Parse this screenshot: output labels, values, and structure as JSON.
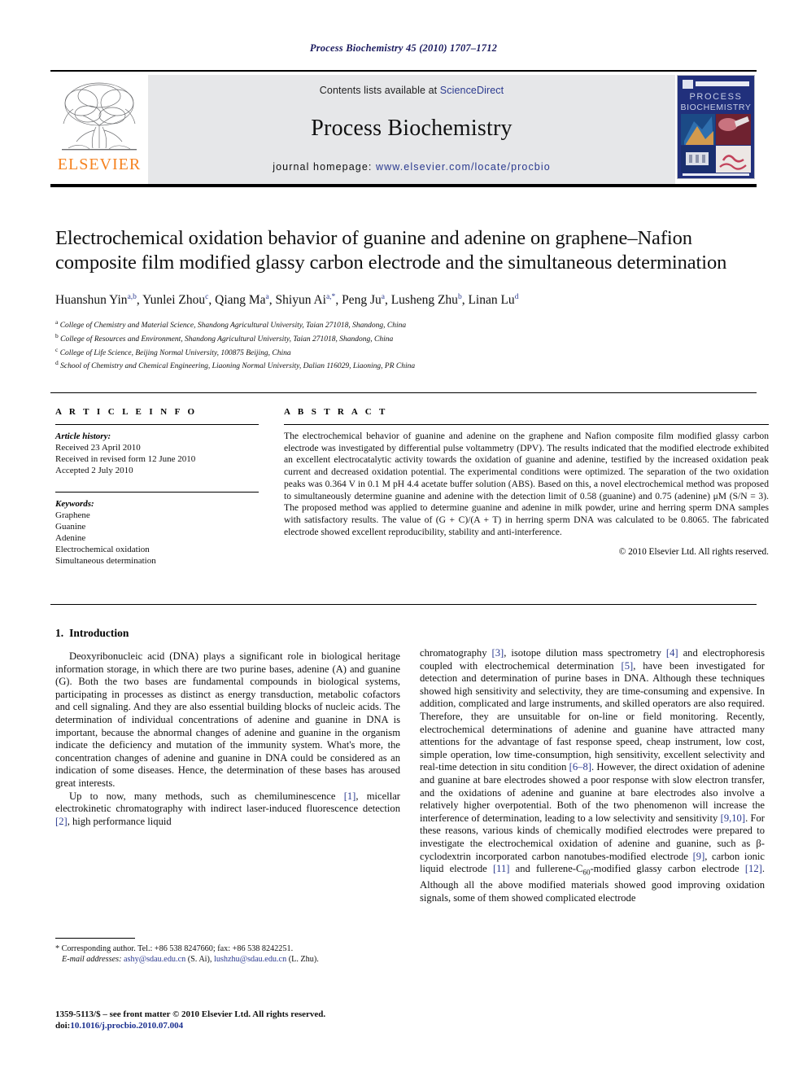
{
  "running_head": "Process Biochemistry 45 (2010) 1707–1712",
  "masthead": {
    "contents_prefix": "Contents lists available at ",
    "sciencedirect": "ScienceDirect",
    "journal_title": "Process Biochemistry",
    "homepage_prefix": "journal homepage: ",
    "homepage_url": "www.elsevier.com/locate/procbio",
    "publisher": "ELSEVIER",
    "cover_title_line1": "PROCESS",
    "cover_title_line2": "BIOCHEMISTRY",
    "accent_orange": "#f58220",
    "link_blue": "#2b3a8f"
  },
  "article": {
    "title": "Electrochemical oxidation behavior of guanine and adenine on graphene–Nafion composite film modified glassy carbon electrode and the simultaneous determination",
    "authors": [
      {
        "name": "Huanshun Yin",
        "sup": "a,b"
      },
      {
        "name": "Yunlei Zhou",
        "sup": "c"
      },
      {
        "name": "Qiang Ma",
        "sup": "a"
      },
      {
        "name": "Shiyun Ai",
        "sup": "a,*"
      },
      {
        "name": "Peng Ju",
        "sup": "a"
      },
      {
        "name": "Lusheng Zhu",
        "sup": "b"
      },
      {
        "name": "Linan Lu",
        "sup": "d"
      }
    ],
    "affiliations": [
      {
        "marker": "a",
        "text": "College of Chemistry and Material Science, Shandong Agricultural University, Taian 271018, Shandong, China"
      },
      {
        "marker": "b",
        "text": "College of Resources and Environment, Shandong Agricultural University, Taian 271018, Shandong, China"
      },
      {
        "marker": "c",
        "text": "College of Life Science, Beijing Normal University, 100875 Beijing, China"
      },
      {
        "marker": "d",
        "text": "School of Chemistry and Chemical Engineering, Liaoning Normal University, Dalian 116029, Liaoning, PR China"
      }
    ]
  },
  "article_info": {
    "heading": "A R T I C L E   I N F O",
    "history_label": "Article history:",
    "history": [
      "Received 23 April 2010",
      "Received in revised form 12 June 2010",
      "Accepted 2 July 2010"
    ],
    "keywords_label": "Keywords:",
    "keywords": [
      "Graphene",
      "Guanine",
      "Adenine",
      "Electrochemical oxidation",
      "Simultaneous determination"
    ]
  },
  "abstract": {
    "heading": "A B S T R A C T",
    "text": "The electrochemical behavior of guanine and adenine on the graphene and Nafion composite film modified glassy carbon electrode was investigated by differential pulse voltammetry (DPV). The results indicated that the modified electrode exhibited an excellent electrocatalytic activity towards the oxidation of guanine and adenine, testified by the increased oxidation peak current and decreased oxidation potential. The experimental conditions were optimized. The separation of the two oxidation peaks was 0.364 V in 0.1 M pH 4.4 acetate buffer solution (ABS). Based on this, a novel electrochemical method was proposed to simultaneously determine guanine and adenine with the detection limit of 0.58 (guanine) and 0.75 (adenine) μM (S/N = 3). The proposed method was applied to determine guanine and adenine in milk powder, urine and herring sperm DNA samples with satisfactory results. The value of (G + C)/(A + T) in herring sperm DNA was calculated to be 0.8065. The fabricated electrode showed excellent reproducibility, stability and anti-interference.",
    "copyright": "© 2010 Elsevier Ltd. All rights reserved."
  },
  "introduction": {
    "number": "1.",
    "title": "Introduction",
    "para1_a": "Deoxyribonucleic acid (DNA) plays a significant role in biological heritage information storage, in which there are two purine bases, adenine (A) and guanine (G). Both the two bases are fundamental compounds in biological systems, participating in processes as distinct as energy transduction, metabolic cofactors and cell signaling. And they are also essential building blocks of nucleic acids. The determination of individual concentrations of adenine and guanine in DNA is important, because the abnormal changes of adenine and guanine in the organism indicate the deficiency and mutation of the immunity system. What's more, the concentration changes of adenine and guanine in DNA could be considered as an indication of some diseases. Hence, the determination of these bases has aroused great interests.",
    "para2_seg1": "Up to now, many methods, such as chemiluminescence ",
    "para2_ref1": "[1]",
    "para2_seg2": ", micellar electrokinetic chromatography with indirect laser-induced fluorescence detection ",
    "para2_ref2": "[2]",
    "para2_seg3": ", high performance liquid chromatography ",
    "para2_ref3": "[3]",
    "para2_seg4": ", isotope dilution mass spectrometry ",
    "para2_ref4": "[4]",
    "para2_seg5": " and electrophoresis coupled with electrochemical determination ",
    "para2_ref5": "[5]",
    "para2_seg6": ", have been investigated for detection and determination of purine bases in DNA. Although these techniques showed high sensitivity and selectivity, they are time-consuming and expensive. In addition, complicated and large instruments, and skilled operators are also required. Therefore, they are unsuitable for on-line or field monitoring. Recently, electrochemical determinations of adenine and guanine have attracted many attentions for the advantage of fast response speed, cheap instrument, low cost, simple operation, low time-consumption, high sensitivity, excellent selectivity and real-time detection in situ condition ",
    "para2_ref6": "[6–8]",
    "para2_seg7": ". However, the direct oxidation of adenine and guanine at bare electrodes showed a poor response with slow electron transfer, and the oxidations of adenine and guanine at bare electrodes also involve a relatively higher overpotential. Both of the two phenomenon will increase the interference of determination, leading to a low selectivity and sensitivity ",
    "para2_ref7": "[9,10]",
    "para2_seg8": ". For these reasons, various kinds of chemically modified electrodes were prepared to investigate the electrochemical oxidation of adenine and guanine, such as β-cyclodextrin incorporated carbon nanotubes-modified electrode ",
    "para2_ref8": "[9]",
    "para2_seg9": ", carbon ionic liquid electrode ",
    "para2_ref9": "[11]",
    "para2_seg10": " and fullerene-C",
    "para2_sub": "60",
    "para2_seg11": "-modified glassy carbon electrode ",
    "para2_ref10": "[12]",
    "para2_seg12": ". Although all the above modified materials showed good improving oxidation signals, some of them showed complicated electrode"
  },
  "footnote": {
    "star": "*",
    "corresponding": " Corresponding author. Tel.: +86 538 8247660; fax: +86 538 8242251.",
    "email_label": "E-mail addresses:",
    "email1": "ashy@sdau.edu.cn",
    "email1_name": " (S. Ai), ",
    "email2": "lushzhu@sdau.edu.cn",
    "email2_name": " (L. Zhu)."
  },
  "footer": {
    "issn_line": "1359-5113/$ – see front matter © 2010 Elsevier Ltd. All rights reserved.",
    "doi_prefix": "doi:",
    "doi": "10.1016/j.procbio.2010.07.004"
  }
}
